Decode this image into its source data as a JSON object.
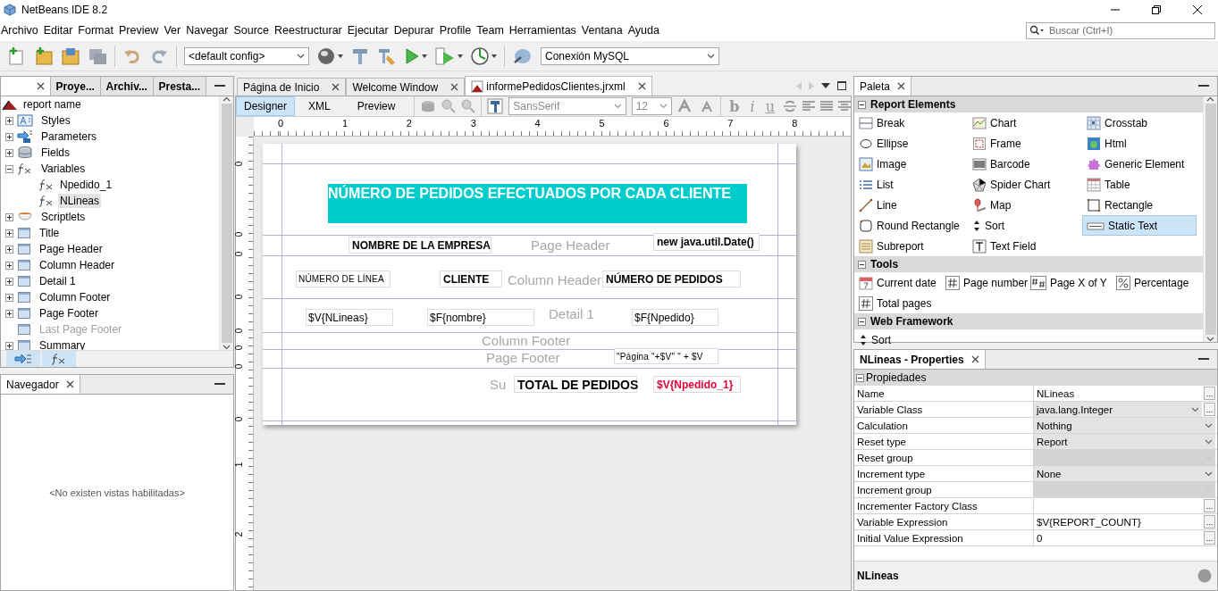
{
  "window": {
    "title": "NetBeans IDE 8.2"
  },
  "menu": [
    "Archivo",
    "Editar",
    "Format",
    "Preview",
    "Ver",
    "Navegar",
    "Source",
    "Reestructurar",
    "Ejecutar",
    "Depurar",
    "Profile",
    "Team",
    "Herramientas",
    "Ventana",
    "Ayuda"
  ],
  "search": {
    "placeholder": "Buscar (Ctrl+I)"
  },
  "toolbar": {
    "config": "<default config>",
    "connection": "Conexión MySQL"
  },
  "explorer": {
    "tabs": [
      {
        "selected": true
      },
      {
        "label": "Proye...",
        "selected": false
      },
      {
        "label": "Archiv...",
        "selected": false
      },
      {
        "label": "Presta...",
        "selected": false
      }
    ],
    "tree": {
      "label": "report name",
      "children": [
        {
          "label": "Styles",
          "kind": "styles",
          "expanded": false,
          "selected": false,
          "disabled": false
        },
        {
          "label": "Parameters",
          "kind": "parameters",
          "expanded": false,
          "selected": false,
          "disabled": false
        },
        {
          "label": "Fields",
          "kind": "fields",
          "expanded": false,
          "selected": false,
          "disabled": false
        },
        {
          "label": "Variables",
          "kind": "variables",
          "expanded": true,
          "selected": false,
          "disabled": false,
          "children": [
            {
              "label": "Npedido_1",
              "kind": "variable",
              "selected": false,
              "disabled": false
            },
            {
              "label": "NLineas",
              "kind": "variable",
              "selected": true,
              "disabled": false
            }
          ]
        },
        {
          "label": "Scriptlets",
          "kind": "scriptlets",
          "expanded": false,
          "selected": false,
          "disabled": false
        },
        {
          "label": "Title",
          "kind": "band",
          "expanded": false,
          "selected": false,
          "disabled": false
        },
        {
          "label": "Page Header",
          "kind": "band",
          "expanded": false,
          "selected": false,
          "disabled": false
        },
        {
          "label": "Column Header",
          "kind": "band",
          "expanded": false,
          "selected": false,
          "disabled": false
        },
        {
          "label": "Detail 1",
          "kind": "band",
          "expanded": false,
          "selected": false,
          "disabled": false
        },
        {
          "label": "Column Footer",
          "kind": "band",
          "expanded": false,
          "selected": false,
          "disabled": false
        },
        {
          "label": "Page Footer",
          "kind": "band",
          "expanded": false,
          "selected": false,
          "disabled": false
        },
        {
          "label": "Last Page Footer",
          "kind": "band",
          "selected": false,
          "disabled": true
        },
        {
          "label": "Summary",
          "kind": "band",
          "expanded": false,
          "selected": false,
          "disabled": false
        }
      ]
    }
  },
  "navigator": {
    "title": "Navegador",
    "message": "<No existen vistas habilitadas>"
  },
  "editor_tabs": [
    {
      "label": "Página de Inicio",
      "selected": false
    },
    {
      "label": "Welcome Window",
      "selected": false
    },
    {
      "label": "informePedidosClientes.jrxml",
      "selected": true
    }
  ],
  "designer": {
    "modes": [
      {
        "label": "Designer",
        "selected": true
      },
      {
        "label": "XML",
        "selected": false
      },
      {
        "label": "Preview",
        "selected": false
      }
    ],
    "font": "SansSerif",
    "font_size": "12",
    "style_buttons": [
      "b",
      "i",
      "u"
    ],
    "ruler": [
      "0",
      "1",
      "2",
      "3",
      "4",
      "5",
      "6",
      "7",
      "8"
    ],
    "vertical_ruler": [
      "0",
      "0",
      "0",
      "0",
      "0",
      "0",
      "0",
      "0",
      "1",
      "2"
    ],
    "report": {
      "bands": [
        "Page Header",
        "Column Header",
        "Detail 1",
        "Column Footer",
        "Page Footer",
        "Su"
      ],
      "elements": [
        {
          "kind": "title",
          "text": "NÚMERO DE PEDIDOS EFECTUADOS POR CADA CLIENTE"
        },
        {
          "kind": "label",
          "text": "NOMBRE DE LA EMPRESA"
        },
        {
          "kind": "label",
          "text": "new java.util.Date()"
        },
        {
          "kind": "small",
          "text": "NÚMERO DE LÍNEA"
        },
        {
          "kind": "label",
          "text": "CLIENTE"
        },
        {
          "kind": "label",
          "text": "NÚMERO DE PEDIDOS"
        },
        {
          "kind": "field",
          "text": "$V{NLineas}"
        },
        {
          "kind": "field",
          "text": "$F{nombre}"
        },
        {
          "kind": "field",
          "text": "$F{Npedido}"
        },
        {
          "kind": "small",
          "text": "\"Página \"+$V\" \" + $V"
        },
        {
          "kind": "total",
          "text": "TOTAL DE PEDIDOS"
        },
        {
          "kind": "label",
          "text": "$V{Npedido_1}",
          "color": "#e4003a"
        }
      ]
    }
  },
  "palette": {
    "title": "Paleta",
    "sections": [
      {
        "title": "Report Elements",
        "expanded": true,
        "items": [
          {
            "label": "Break",
            "selected": false
          },
          {
            "label": "Chart",
            "selected": false
          },
          {
            "label": "Crosstab",
            "selected": false
          },
          {
            "label": "Ellipse",
            "selected": false
          },
          {
            "label": "Frame",
            "selected": false
          },
          {
            "label": "Html",
            "selected": false
          },
          {
            "label": "Image",
            "selected": false
          },
          {
            "label": "Barcode",
            "selected": false
          },
          {
            "label": "Generic Element",
            "selected": false
          },
          {
            "label": "List",
            "selected": false
          },
          {
            "label": "Spider Chart",
            "selected": false
          },
          {
            "label": "Table",
            "selected": false
          },
          {
            "label": "Line",
            "selected": false
          },
          {
            "label": "Map",
            "selected": false
          },
          {
            "label": "Rectangle",
            "selected": false
          },
          {
            "label": "Round Rectangle",
            "selected": false
          },
          {
            "label": "Sort",
            "selected": false
          },
          {
            "label": "Static Text",
            "selected": true
          },
          {
            "label": "Subreport",
            "selected": false
          },
          {
            "label": "Text Field",
            "selected": false
          }
        ]
      },
      {
        "title": "Tools",
        "expanded": true,
        "items": [
          {
            "label": "Current date",
            "selected": false
          },
          {
            "label": "Page number",
            "selected": false
          },
          {
            "label": "Page X of Y",
            "selected": false
          },
          {
            "label": "Percentage",
            "selected": false
          },
          {
            "label": "Total pages",
            "selected": false
          }
        ]
      },
      {
        "title": "Web Framework",
        "expanded": true,
        "items": [
          {
            "label": "Sort",
            "selected": false
          }
        ]
      }
    ]
  },
  "properties": {
    "title": "NLineas - Properties",
    "section": "Propiedades",
    "rows": [
      {
        "name": "Name",
        "value": "NLineas",
        "kind": "text",
        "button": "...",
        "disabled": false
      },
      {
        "name": "Variable Class",
        "value": "java.lang.Integer",
        "kind": "select",
        "button": "...",
        "disabled": false
      },
      {
        "name": "Calculation",
        "value": "Nothing",
        "kind": "select",
        "disabled": false
      },
      {
        "name": "Reset type",
        "value": "Report",
        "kind": "select",
        "disabled": false
      },
      {
        "name": "Reset group",
        "kind": "select",
        "disabled": true
      },
      {
        "name": "Increment type",
        "value": "None",
        "kind": "select",
        "disabled": false
      },
      {
        "name": "Increment group",
        "kind": "select",
        "disabled": true
      },
      {
        "name": "Incrementer Factory Class",
        "kind": "text",
        "button": "...",
        "disabled": false
      },
      {
        "name": "Variable Expression",
        "value": "$V{REPORT_COUNT}",
        "kind": "text",
        "button": "...",
        "disabled": false
      },
      {
        "name": "Initial Value Expression",
        "value": "0",
        "kind": "text",
        "button": "...",
        "disabled": false
      }
    ],
    "description": "NLineas"
  }
}
